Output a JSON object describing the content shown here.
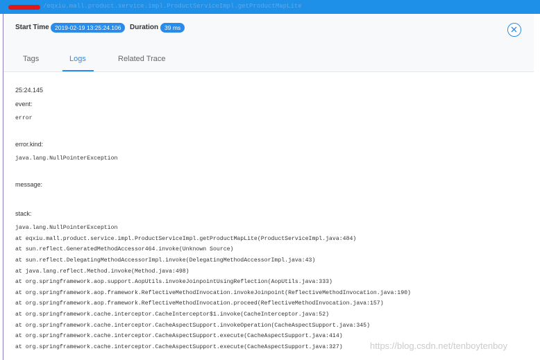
{
  "endpoint": {
    "url": "/eqxiu.mall.product.service.impl.ProductServiceImpl.getProductMapLite"
  },
  "header": {
    "start_time_label": "Start Time",
    "start_time_value": "2019-02-19 13:25:24.106",
    "duration_label": "Duration",
    "duration_value": "39 ms"
  },
  "tabs": [
    {
      "label": "Tags"
    },
    {
      "label": "Logs"
    },
    {
      "label": "Related Trace"
    }
  ],
  "active_tab": "Logs",
  "log": {
    "time": "25:24.145",
    "fields": [
      {
        "key": "event:",
        "value": "error"
      },
      {
        "key": "error.kind:",
        "value": "java.lang.NullPointerException"
      },
      {
        "key": "message:",
        "value": ""
      }
    ],
    "stack_label": "stack:",
    "stack_lines": [
      "java.lang.NullPointerException",
      "at eqxiu.mall.product.service.impl.ProductServiceImpl.getProductMapLite(ProductServiceImpl.java:484)",
      "at sun.reflect.GeneratedMethodAccessor464.invoke(Unknown Source)",
      "at sun.reflect.DelegatingMethodAccessorImpl.invoke(DelegatingMethodAccessorImpl.java:43)",
      "at java.lang.reflect.Method.invoke(Method.java:498)",
      "at org.springframework.aop.support.AopUtils.invokeJoinpointUsingReflection(AopUtils.java:333)",
      "at org.springframework.aop.framework.ReflectiveMethodInvocation.invokeJoinpoint(ReflectiveMethodInvocation.java:190)",
      "at org.springframework.aop.framework.ReflectiveMethodInvocation.proceed(ReflectiveMethodInvocation.java:157)",
      "at org.springframework.cache.interceptor.CacheInterceptor$1.invoke(CacheInterceptor.java:52)",
      "at org.springframework.cache.interceptor.CacheAspectSupport.invokeOperation(CacheAspectSupport.java:345)",
      "at org.springframework.cache.interceptor.CacheAspectSupport.execute(CacheAspectSupport.java:414)",
      "at org.springframework.cache.interceptor.CacheAspectSupport.execute(CacheAspectSupport.java:327)"
    ]
  },
  "watermark": "https://blog.csdn.net/tenboytenboy",
  "colors": {
    "accent": "#2b8be8",
    "topbar": "#1e90e8",
    "redaction": "#e01818"
  },
  "icons": {
    "close": "close-icon"
  }
}
